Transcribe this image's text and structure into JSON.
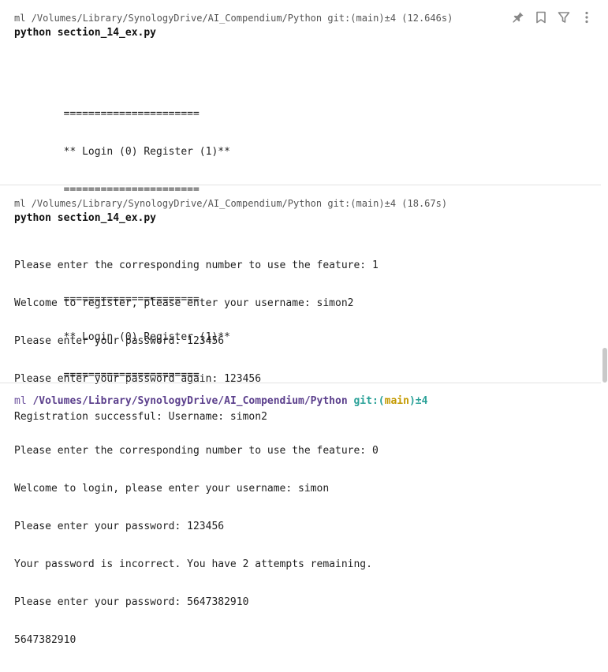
{
  "toolbar": {
    "icons": [
      "pin-icon",
      "bookmark-icon",
      "filter-icon",
      "more-vert-icon"
    ]
  },
  "blocks": [
    {
      "meta": "ml /Volumes/Library/SynologyDrive/AI_Compendium/Python git:(main)±4 (12.646s)",
      "command": "python section_14_ex.py",
      "output": [
        "",
        "        ======================",
        "        ** Login (0) Register (1)**",
        "        ======================",
        "",
        "Please enter the corresponding number to use the feature: 1",
        "Welcome to register, please enter your username: simon2",
        "Please enter your password: 123456",
        "Please enter your password again: 123456",
        "Registration successful: Username: simon2"
      ]
    },
    {
      "meta": "ml /Volumes/Library/SynologyDrive/AI_Compendium/Python git:(main)±4 (18.67s)",
      "command": "python section_14_ex.py",
      "output": [
        "",
        "        ======================",
        "        ** Login (0) Register (1)**",
        "        ======================",
        "",
        "Please enter the corresponding number to use the feature: 0",
        "Welcome to login, please enter your username: simon",
        "Please enter your password: 123456",
        "Your password is incorrect. You have 2 attempts remaining.",
        "Please enter your password: 5647382910",
        "5647382910"
      ]
    }
  ],
  "prompt": {
    "env": "ml",
    "path": "/Volumes/Library/SynologyDrive/AI_Compendium/Python",
    "git_label": "git:(",
    "branch": "main",
    "git_close": ")",
    "dirty": "±4"
  },
  "colors": {
    "prompt_path": "#5b3f8c",
    "git": "#2aa198",
    "branch": "#c49a00"
  }
}
